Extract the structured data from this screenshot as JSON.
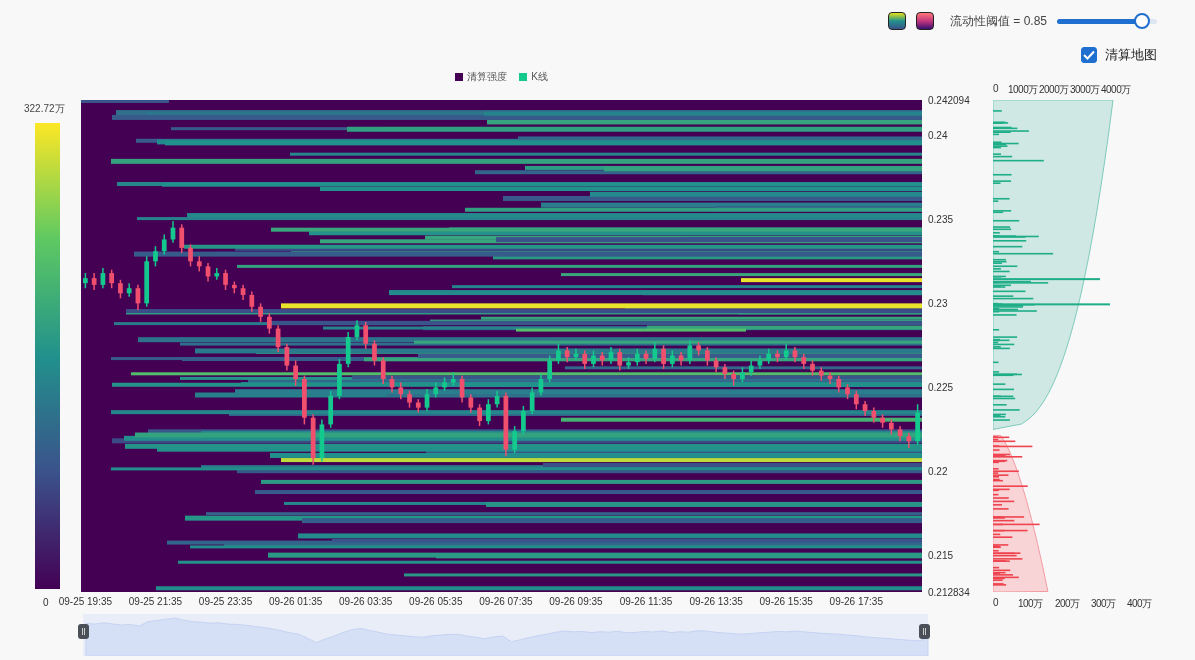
{
  "controls": {
    "threshold": {
      "label": "流动性阈值 = 0.85",
      "level": 0.85
    },
    "liquidation_map": {
      "label": "清算地图",
      "checked": true
    }
  },
  "legend": [
    {
      "label": "清算强度",
      "color": "#440154"
    },
    {
      "label": "K线",
      "color": "#13c98c"
    }
  ],
  "colorbar": {
    "max_label": "322.72万",
    "min_label": "0"
  },
  "heatmap": {
    "chart_data": {
      "type": "candlestick",
      "ylim": [
        0.212834,
        0.242094
      ],
      "categories": [
        "09-25 19:35",
        null,
        null,
        null,
        null,
        null,
        null,
        null,
        "09-25 21:35",
        null,
        null,
        null,
        null,
        null,
        null,
        null,
        "09-25 23:35",
        null,
        null,
        null,
        null,
        null,
        null,
        null,
        "09-26 01:35",
        null,
        null,
        null,
        null,
        null,
        null,
        null,
        "09-26 03:35",
        null,
        null,
        null,
        null,
        null,
        null,
        null,
        "09-26 05:35",
        null,
        null,
        null,
        null,
        null,
        null,
        null,
        "09-26 07:35",
        null,
        null,
        null,
        null,
        null,
        null,
        null,
        "09-26 09:35",
        null,
        null,
        null,
        null,
        null,
        null,
        null,
        "09-26 11:35",
        null,
        null,
        null,
        null,
        null,
        null,
        null,
        "09-26 13:35",
        null,
        null,
        null,
        null,
        null,
        null,
        null,
        "09-26 15:35",
        null,
        null,
        null,
        null,
        null,
        null,
        null,
        "09-26 17:35",
        null,
        null,
        null,
        null,
        null,
        null,
        null
      ],
      "yticks": [
        {
          "value": 0.242094,
          "label": "0.242094"
        },
        {
          "value": 0.24,
          "label": "0.24"
        },
        {
          "value": 0.235,
          "label": "0.235"
        },
        {
          "value": 0.23,
          "label": "0.23"
        },
        {
          "value": 0.225,
          "label": "0.225"
        },
        {
          "value": 0.22,
          "label": "0.22"
        },
        {
          "value": 0.215,
          "label": "0.215"
        },
        {
          "value": 0.212834,
          "label": "0.212834"
        }
      ],
      "ohlc": [
        [
          0.2312,
          0.2318,
          0.2309,
          0.2315
        ],
        [
          0.2315,
          0.2318,
          0.2308,
          0.2311
        ],
        [
          0.2311,
          0.2321,
          0.2309,
          0.2318
        ],
        [
          0.2318,
          0.232,
          0.2309,
          0.2312
        ],
        [
          0.2312,
          0.2314,
          0.2303,
          0.2306
        ],
        [
          0.2306,
          0.2312,
          0.2304,
          0.2309
        ],
        [
          0.2309,
          0.2311,
          0.2296,
          0.23
        ],
        [
          0.23,
          0.2328,
          0.2298,
          0.2325
        ],
        [
          0.2325,
          0.2334,
          0.2322,
          0.2331
        ],
        [
          0.2331,
          0.2341,
          0.2329,
          0.2338
        ],
        [
          0.2338,
          0.2349,
          0.2336,
          0.2345
        ],
        [
          0.2345,
          0.2347,
          0.233,
          0.2333
        ],
        [
          0.2333,
          0.2335,
          0.2322,
          0.2325
        ],
        [
          0.2325,
          0.2328,
          0.2319,
          0.2322
        ],
        [
          0.2322,
          0.2324,
          0.2313,
          0.2316
        ],
        [
          0.2316,
          0.2321,
          0.2314,
          0.2318
        ],
        [
          0.2318,
          0.232,
          0.2308,
          0.2311
        ],
        [
          0.2311,
          0.2313,
          0.2306,
          0.2309
        ],
        [
          0.2309,
          0.2311,
          0.2302,
          0.2305
        ],
        [
          0.2305,
          0.2307,
          0.2295,
          0.2298
        ],
        [
          0.2298,
          0.23,
          0.2289,
          0.2292
        ],
        [
          0.2292,
          0.2294,
          0.2282,
          0.2285
        ],
        [
          0.2285,
          0.2287,
          0.2271,
          0.2274
        ],
        [
          0.2274,
          0.2276,
          0.226,
          0.2263
        ],
        [
          0.2263,
          0.2266,
          0.2251,
          0.2255
        ],
        [
          0.2255,
          0.2257,
          0.2228,
          0.2232
        ],
        [
          0.2232,
          0.2234,
          0.2204,
          0.2208
        ],
        [
          0.2208,
          0.2231,
          0.2206,
          0.2228
        ],
        [
          0.2228,
          0.2248,
          0.2226,
          0.2245
        ],
        [
          0.2245,
          0.2267,
          0.2243,
          0.2264
        ],
        [
          0.2264,
          0.2283,
          0.2262,
          0.228
        ],
        [
          0.228,
          0.229,
          0.2278,
          0.2287
        ],
        [
          0.2287,
          0.2289,
          0.2273,
          0.2276
        ],
        [
          0.2276,
          0.2278,
          0.2263,
          0.2266
        ],
        [
          0.2266,
          0.2268,
          0.2252,
          0.2255
        ],
        [
          0.2255,
          0.2257,
          0.2247,
          0.225
        ],
        [
          0.225,
          0.2253,
          0.2243,
          0.2246
        ],
        [
          0.2246,
          0.2248,
          0.2238,
          0.2241
        ],
        [
          0.2241,
          0.2243,
          0.2235,
          0.2238
        ],
        [
          0.2238,
          0.2249,
          0.2236,
          0.2246
        ],
        [
          0.2246,
          0.2253,
          0.2244,
          0.225
        ],
        [
          0.225,
          0.2256,
          0.2248,
          0.2253
        ],
        [
          0.2253,
          0.2259,
          0.2251,
          0.2255
        ],
        [
          0.2255,
          0.2257,
          0.2241,
          0.2244
        ],
        [
          0.2244,
          0.2246,
          0.2235,
          0.2238
        ],
        [
          0.2238,
          0.224,
          0.2227,
          0.223
        ],
        [
          0.223,
          0.2243,
          0.2228,
          0.224
        ],
        [
          0.224,
          0.2248,
          0.2238,
          0.2245
        ],
        [
          0.2245,
          0.2247,
          0.2209,
          0.2213
        ],
        [
          0.2213,
          0.2227,
          0.2211,
          0.2224
        ],
        [
          0.2224,
          0.2239,
          0.2222,
          0.2236
        ],
        [
          0.2236,
          0.225,
          0.2234,
          0.2247
        ],
        [
          0.2247,
          0.2258,
          0.2245,
          0.2255
        ],
        [
          0.2255,
          0.2269,
          0.2253,
          0.2266
        ],
        [
          0.2266,
          0.2276,
          0.2264,
          0.2272
        ],
        [
          0.2272,
          0.2274,
          0.2265,
          0.2268
        ],
        [
          0.2268,
          0.2273,
          0.2266,
          0.227
        ],
        [
          0.227,
          0.2272,
          0.2261,
          0.2264
        ],
        [
          0.2264,
          0.2272,
          0.2262,
          0.2269
        ],
        [
          0.2269,
          0.2271,
          0.2263,
          0.2266
        ],
        [
          0.2266,
          0.2274,
          0.2264,
          0.2271
        ],
        [
          0.2271,
          0.2273,
          0.226,
          0.2263
        ],
        [
          0.2263,
          0.2268,
          0.2261,
          0.2265
        ],
        [
          0.2265,
          0.2273,
          0.2263,
          0.227
        ],
        [
          0.227,
          0.2272,
          0.2264,
          0.2267
        ],
        [
          0.2267,
          0.2277,
          0.2265,
          0.2273
        ],
        [
          0.2273,
          0.2275,
          0.2261,
          0.2264
        ],
        [
          0.2264,
          0.2272,
          0.2262,
          0.2269
        ],
        [
          0.2269,
          0.2271,
          0.2263,
          0.2266
        ],
        [
          0.2266,
          0.2278,
          0.2264,
          0.2275
        ],
        [
          0.2275,
          0.2277,
          0.2269,
          0.2272
        ],
        [
          0.2272,
          0.2274,
          0.2263,
          0.2266
        ],
        [
          0.2266,
          0.2268,
          0.2259,
          0.2262
        ],
        [
          0.2262,
          0.2264,
          0.2255,
          0.2258
        ],
        [
          0.2258,
          0.226,
          0.2251,
          0.2255
        ],
        [
          0.2255,
          0.2262,
          0.2253,
          0.2259
        ],
        [
          0.2259,
          0.2266,
          0.2257,
          0.2263
        ],
        [
          0.2263,
          0.2269,
          0.2261,
          0.2266
        ],
        [
          0.2266,
          0.2273,
          0.2264,
          0.227
        ],
        [
          0.227,
          0.2272,
          0.2265,
          0.2268
        ],
        [
          0.2268,
          0.2276,
          0.2266,
          0.2272
        ],
        [
          0.2272,
          0.2274,
          0.2265,
          0.2268
        ],
        [
          0.2268,
          0.227,
          0.2261,
          0.2264
        ],
        [
          0.2264,
          0.2266,
          0.2257,
          0.226
        ],
        [
          0.226,
          0.2262,
          0.2254,
          0.2257
        ],
        [
          0.2257,
          0.2259,
          0.2252,
          0.2255
        ],
        [
          0.2255,
          0.2257,
          0.2247,
          0.225
        ],
        [
          0.225,
          0.2252,
          0.2243,
          0.2246
        ],
        [
          0.2246,
          0.2248,
          0.2237,
          0.224
        ],
        [
          0.224,
          0.2242,
          0.2233,
          0.2236
        ],
        [
          0.2236,
          0.2238,
          0.2229,
          0.2232
        ],
        [
          0.2232,
          0.2234,
          0.2226,
          0.2229
        ],
        [
          0.2229,
          0.2231,
          0.2222,
          0.2225
        ],
        [
          0.2225,
          0.2227,
          0.2218,
          0.2221
        ],
        [
          0.2221,
          0.2223,
          0.2214,
          0.2218
        ],
        [
          0.2218,
          0.224,
          0.2216,
          0.2235
        ]
      ]
    }
  },
  "histogram": {
    "top_ticks": [
      "0",
      "1000万",
      "2000万",
      "3000万",
      "4000万"
    ],
    "bottom_ticks": [
      "0",
      "100万",
      "200万",
      "300万",
      "400万"
    ]
  },
  "zoom_range": {
    "level": 1
  }
}
